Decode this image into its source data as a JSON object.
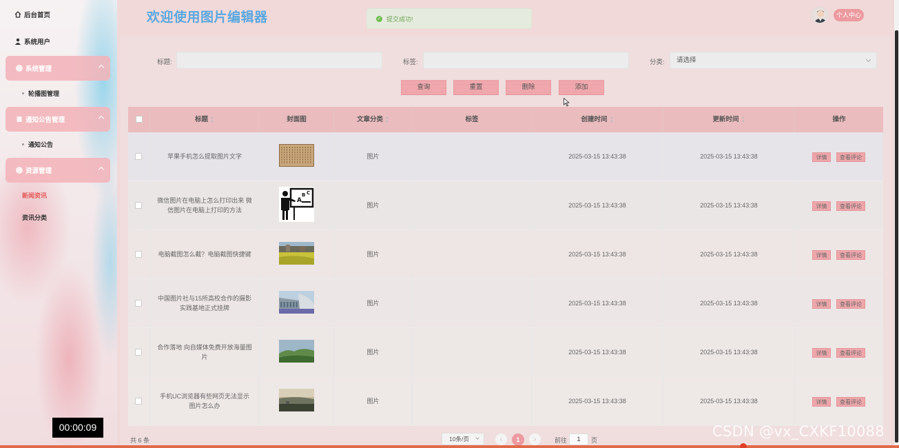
{
  "sidebar": {
    "items": [
      {
        "label": "后台首页",
        "type": "plain",
        "icon": "home-icon"
      },
      {
        "label": "系统用户",
        "type": "plain",
        "icon": "user-icon"
      },
      {
        "label": "系统管理",
        "type": "group",
        "icon": "settings-icon",
        "children": [
          "轮播图管理"
        ]
      },
      {
        "label": "通知公告管理",
        "type": "group",
        "icon": "notice-icon",
        "children": [
          "通知公告"
        ]
      },
      {
        "label": "资源管理",
        "type": "group",
        "icon": "resource-icon",
        "children": [
          "新闻资讯",
          "资讯分类"
        ]
      }
    ],
    "active": "新闻资讯"
  },
  "header": {
    "title": "欢迎使用图片编辑器",
    "toast": "提交成功!",
    "user_button": "个人中心"
  },
  "search": {
    "title_label": "标题:",
    "tag_label": "标签:",
    "category_label": "分类:",
    "category_placeholder": "请选择",
    "title_value": "",
    "tag_value": ""
  },
  "actions": {
    "query": "查询",
    "reset": "重置",
    "delete": "删除",
    "add": "添加"
  },
  "table": {
    "columns": [
      "标题",
      "封面图",
      "文章分类",
      "标签",
      "创建时间",
      "更新时间",
      "操作"
    ],
    "rows": [
      {
        "title": "苹果手机怎么提取图片文字",
        "category": "图片",
        "tag": "",
        "created": "2025-03-15 13:43:38",
        "updated": "2025-03-15 13:43:38",
        "cover": "calligraphy-image"
      },
      {
        "title": "微信图片在电脑上怎么打印出来 微信图片在电脑上打印的方法",
        "category": "图片",
        "tag": "",
        "created": "2025-03-15 13:43:38",
        "updated": "2025-03-15 13:43:38",
        "cover": "teacher-board-image"
      },
      {
        "title": "电脑截图怎么截？电脑截图快捷键",
        "category": "图片",
        "tag": "",
        "created": "2025-03-15 13:43:38",
        "updated": "2025-03-15 13:43:38",
        "cover": "flower-field-image"
      },
      {
        "title": "中国图片社与15所高校合作的摄影实践基地正式挂牌",
        "category": "图片",
        "tag": "",
        "created": "2025-03-15 13:43:38",
        "updated": "2025-03-15 13:43:38",
        "cover": "building-image"
      },
      {
        "title": "合作落地 向自媒体免费开放海量图片",
        "category": "图片",
        "tag": "",
        "created": "2025-03-15 13:43:38",
        "updated": "2025-03-15 13:43:38",
        "cover": "mountain-image"
      },
      {
        "title": "手机UC浏览器有些网页无法显示图片怎么办",
        "category": "图片",
        "tag": "",
        "created": "2025-03-15 13:43:38",
        "updated": "2025-03-15 13:43:38",
        "cover": "sunset-landscape-image"
      }
    ],
    "op_detail": "详情",
    "op_comments": "查看评论"
  },
  "pagination": {
    "total": "共 6 条",
    "page_size": "10条/页",
    "current_page": "1",
    "goto_prefix": "前往",
    "goto_value": "1",
    "goto_suffix": "页"
  },
  "overlay": {
    "timer": "00:00:09",
    "watermark": "CSDN @vx_CXKF10088"
  },
  "colors": {
    "accent": "#ec9aa0",
    "title": "#5aa8e0",
    "active_menu": "#e45a5a",
    "success": "#6fbf4f"
  }
}
